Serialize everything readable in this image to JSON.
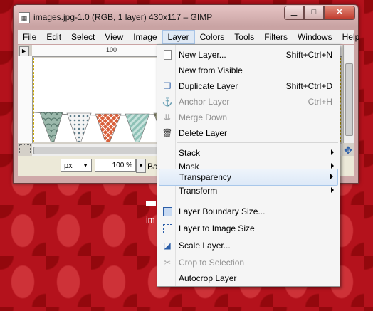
{
  "window": {
    "title": "images.jpg-1.0 (RGB, 1 layer) 430x117 – GIMP",
    "app_icon": "gimp-icon",
    "minimize": "▁",
    "maximize": "□",
    "close": "✕"
  },
  "menubar": [
    {
      "label": "File"
    },
    {
      "label": "Edit"
    },
    {
      "label": "Select"
    },
    {
      "label": "View"
    },
    {
      "label": "Image"
    },
    {
      "label": "Layer"
    },
    {
      "label": "Colors"
    },
    {
      "label": "Tools"
    },
    {
      "label": "Filters"
    },
    {
      "label": "Windows"
    },
    {
      "label": "Help"
    }
  ],
  "ruler": {
    "tick_100": "100"
  },
  "status": {
    "unit": "px",
    "zoom": "100 %",
    "text": "Backgr"
  },
  "desktop": {
    "label1": "—",
    "label2": "im"
  },
  "layer_menu": {
    "items": [
      {
        "label": "New Layer...",
        "shortcut": "Shift+Ctrl+N",
        "icon": "new-layer-icon",
        "enabled": true
      },
      {
        "label": "New from Visible",
        "shortcut": "",
        "icon": "",
        "enabled": true
      },
      {
        "label": "Duplicate Layer",
        "shortcut": "Shift+Ctrl+D",
        "icon": "duplicate-layer-icon",
        "enabled": true
      },
      {
        "label": "Anchor Layer",
        "shortcut": "Ctrl+H",
        "icon": "anchor-icon",
        "enabled": false
      },
      {
        "label": "Merge Down",
        "shortcut": "",
        "icon": "merge-down-icon",
        "enabled": false
      },
      {
        "label": "Delete Layer",
        "shortcut": "",
        "icon": "delete-layer-icon",
        "enabled": true
      },
      {
        "label": "Stack",
        "submenu": true,
        "enabled": true
      },
      {
        "label": "Mask",
        "submenu": true,
        "enabled": true
      },
      {
        "label": "Transparency",
        "submenu": true,
        "enabled": true,
        "highlighted": true
      },
      {
        "label": "Transform",
        "submenu": true,
        "enabled": true
      },
      {
        "label": "Layer Boundary Size...",
        "icon": "layer-boundary-icon",
        "enabled": true
      },
      {
        "label": "Layer to Image Size",
        "icon": "layer-to-image-icon",
        "enabled": true
      },
      {
        "label": "Scale Layer...",
        "icon": "scale-layer-icon",
        "enabled": true
      },
      {
        "label": "Crop to Selection",
        "icon": "crop-icon",
        "enabled": false
      },
      {
        "label": "Autocrop Layer",
        "icon": "",
        "enabled": true
      }
    ]
  },
  "bunting": {
    "flags": [
      {
        "color": "#7fa89a",
        "pattern": "scallop"
      },
      {
        "color": "#e8e8e8",
        "pattern": "dots"
      },
      {
        "color": "#d9603b",
        "pattern": "lattice"
      },
      {
        "color": "#9cc9c0",
        "pattern": "stripes"
      },
      {
        "color": "#8a8a74",
        "pattern": "check"
      }
    ]
  }
}
